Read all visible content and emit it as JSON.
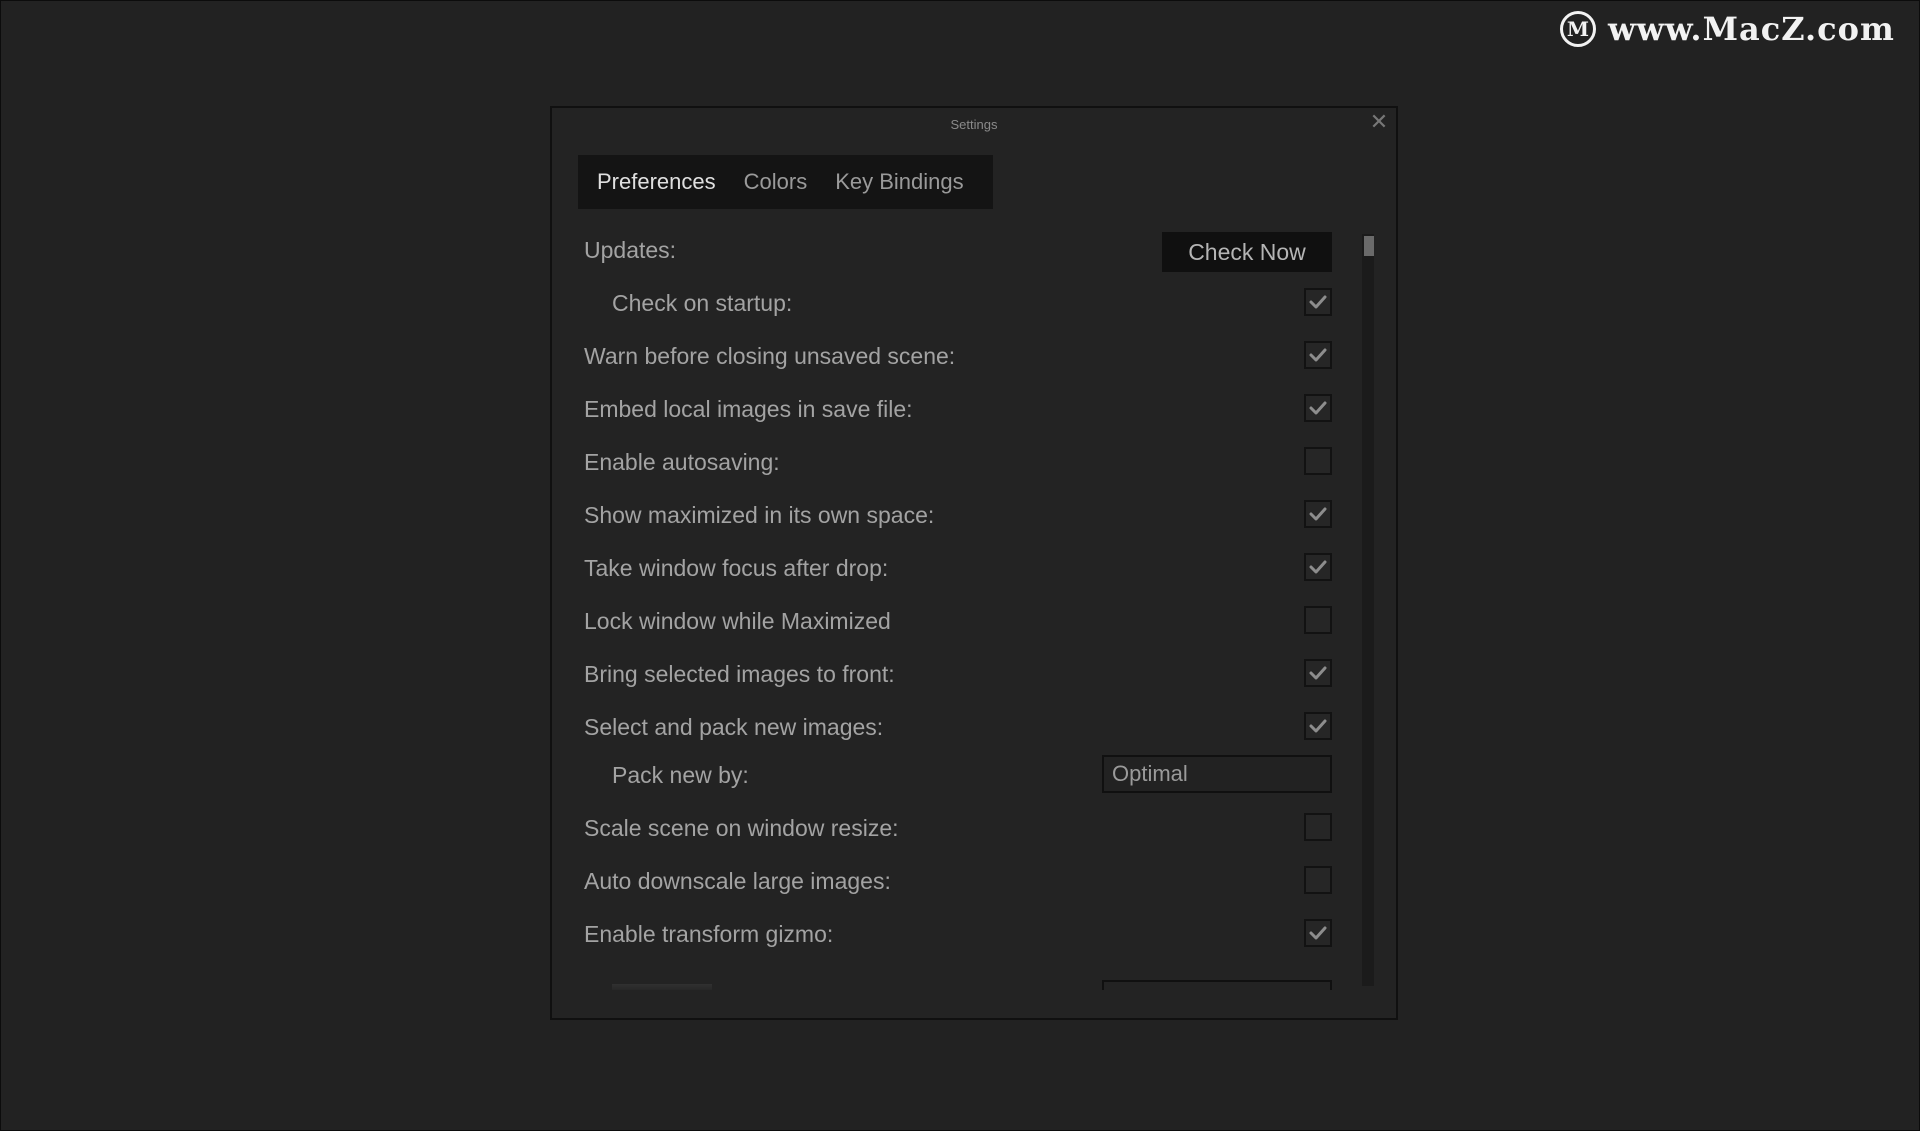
{
  "watermark": {
    "logo_letter": "M",
    "text": "www.MacZ.com"
  },
  "dialog": {
    "title": "Settings",
    "close_glyph": "✕",
    "tabs": [
      {
        "label": "Preferences",
        "active": true
      },
      {
        "label": "Colors",
        "active": false
      },
      {
        "label": "Key Bindings",
        "active": false
      }
    ]
  },
  "preferences": {
    "updates_label": "Updates:",
    "check_now_label": "Check Now",
    "check_on_startup": {
      "label": "Check on startup:",
      "checked": true
    },
    "warn_before_closing": {
      "label": "Warn before closing unsaved scene:",
      "checked": true
    },
    "embed_local_images": {
      "label": "Embed local images in save file:",
      "checked": true
    },
    "enable_autosaving": {
      "label": "Enable autosaving:",
      "checked": false
    },
    "show_maximized": {
      "label": "Show maximized in its own space:",
      "checked": true
    },
    "take_window_focus": {
      "label": "Take window focus after drop:",
      "checked": true
    },
    "lock_window": {
      "label": "Lock window while Maximized",
      "checked": false
    },
    "bring_selected_front": {
      "label": "Bring selected images to front:",
      "checked": true
    },
    "select_and_pack": {
      "label": "Select and pack new images:",
      "checked": true
    },
    "pack_new_by": {
      "label": "Pack new by:",
      "value": "Optimal"
    },
    "scale_scene": {
      "label": "Scale scene on window resize:",
      "checked": false
    },
    "auto_downscale": {
      "label": "Auto downscale large images:",
      "checked": false
    },
    "enable_transform_gizmo": {
      "label": "Enable transform gizmo:",
      "checked": true
    }
  },
  "icons": {
    "check": "check-icon",
    "close": "close-icon"
  },
  "colors": {
    "background": "#222222",
    "dialog": "#232323",
    "tab_bar": "#141414",
    "text": "#a3a3a3"
  }
}
